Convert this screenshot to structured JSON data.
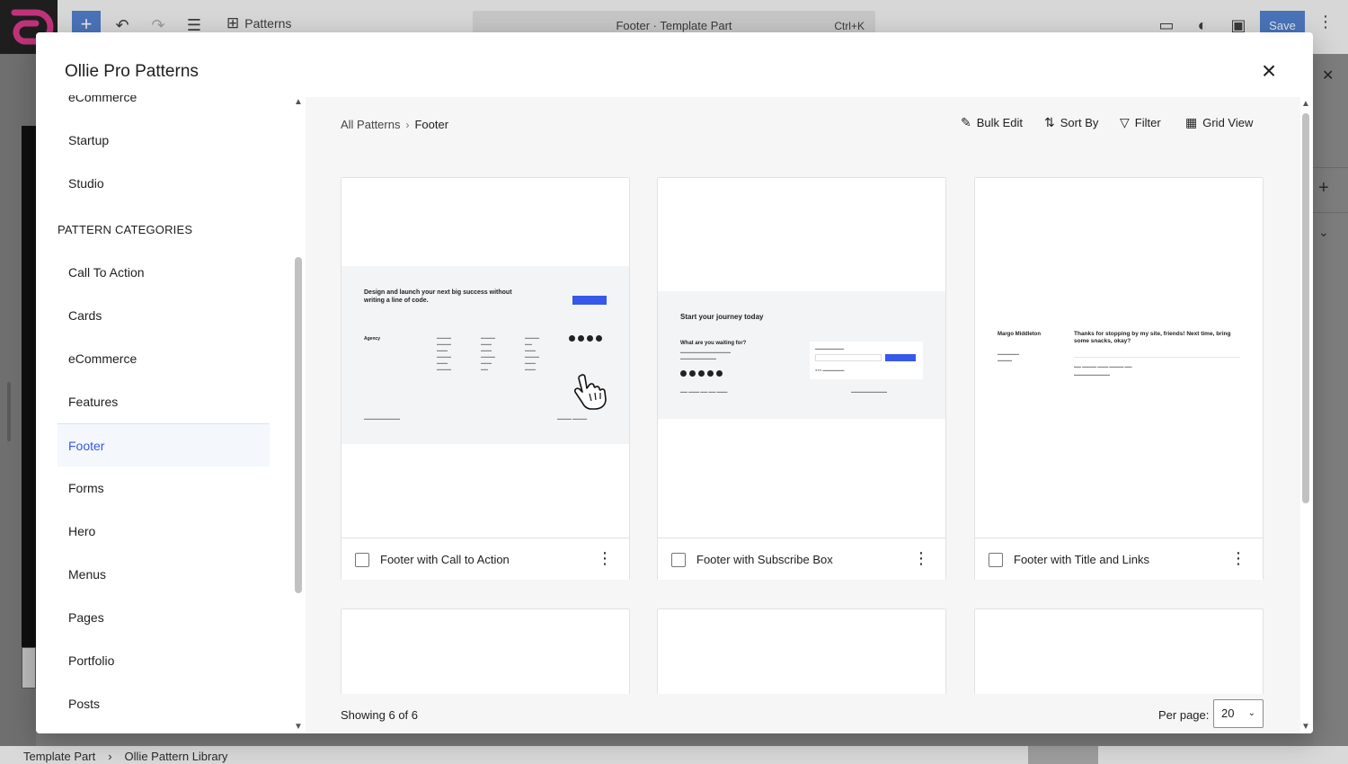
{
  "editor": {
    "patterns_label": "Patterns",
    "document_title": "Footer · Template Part",
    "command_shortcut": "Ctrl+K",
    "save_label": "Save",
    "breadcrumb": [
      "Template Part",
      "Ollie Pattern Library"
    ]
  },
  "modal": {
    "title": "Ollie Pro Patterns",
    "sidebar": {
      "top_items": [
        "eCommerce",
        "Startup",
        "Studio"
      ],
      "heading": "PATTERN CATEGORIES",
      "categories": [
        "Call To Action",
        "Cards",
        "eCommerce",
        "Features",
        "Footer",
        "Forms",
        "Hero",
        "Menus",
        "Pages",
        "Portfolio",
        "Posts"
      ],
      "active": "Footer"
    },
    "breadcrumb": {
      "root": "All Patterns",
      "current": "Footer"
    },
    "toolbar": {
      "bulk_edit": "Bulk Edit",
      "sort_by": "Sort By",
      "filter": "Filter",
      "grid_view": "Grid View"
    },
    "cards": [
      {
        "name": "Footer with Call to Action",
        "preview": {
          "headline": "Design and launch your next big success without writing a line of code.",
          "brand": "Agency"
        }
      },
      {
        "name": "Footer with Subscribe Box",
        "preview": {
          "headline": "Start your journey today",
          "subhead": "What are you waiting for?"
        }
      },
      {
        "name": "Footer with Title and Links",
        "preview": {
          "brand": "Margo Middleton",
          "message": "Thanks for stopping by my site, friends! Next time, bring some snacks, okay?"
        }
      }
    ],
    "showing": "Showing 6 of 6",
    "per_page_label": "Per page:",
    "per_page_value": "20"
  },
  "colors": {
    "accent": "#3858e9",
    "editor_blue": "#4a73b8"
  }
}
